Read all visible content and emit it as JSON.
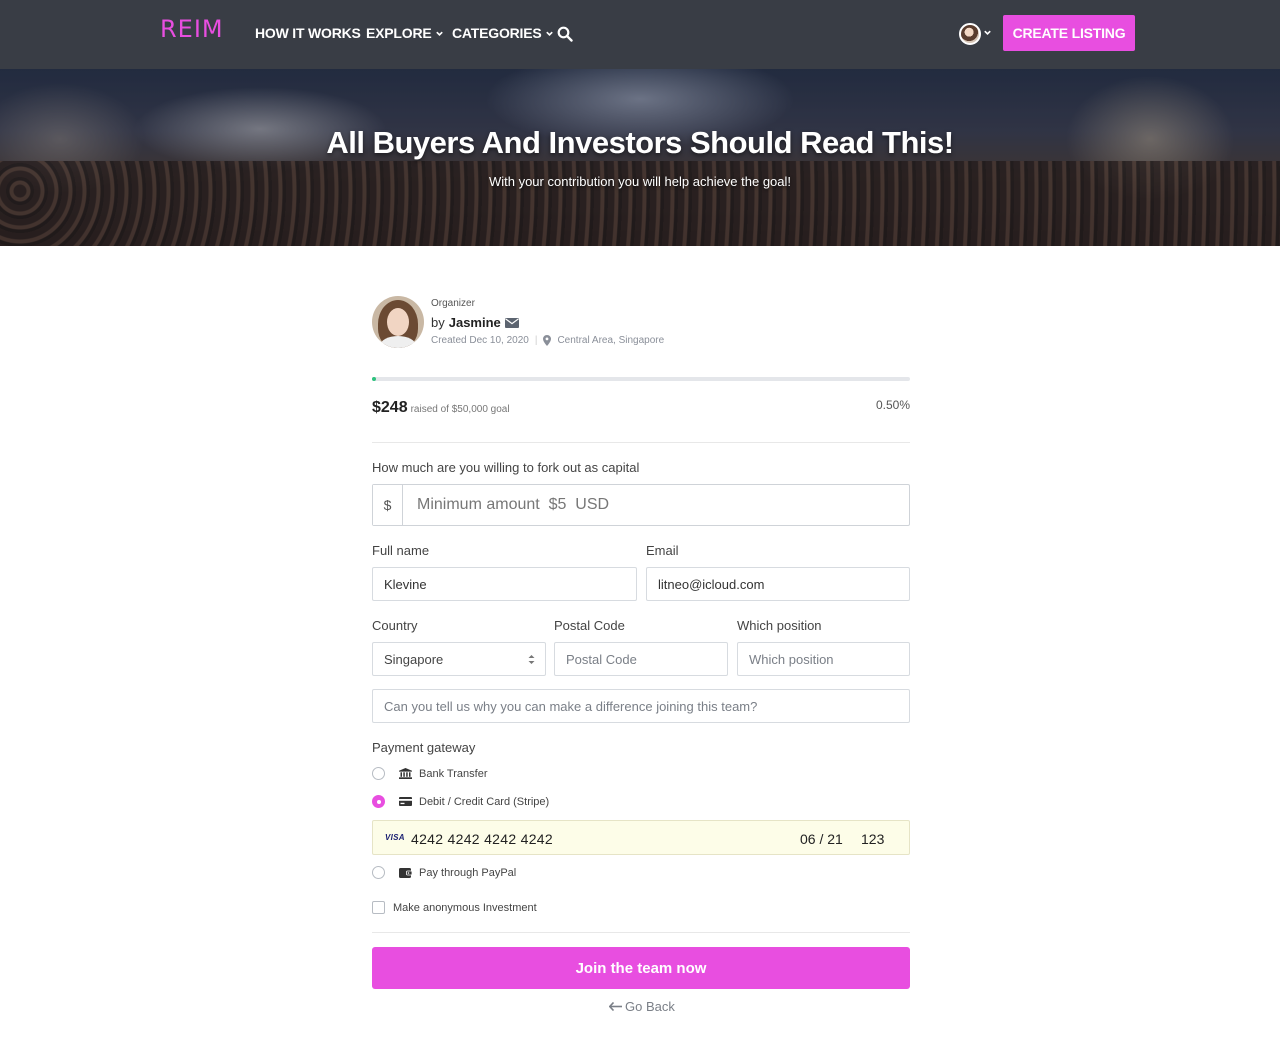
{
  "nav": {
    "logo": "REIM",
    "items": [
      {
        "label": "HOW IT WORKS"
      },
      {
        "label": "EXPLORE"
      },
      {
        "label": "CATEGORIES"
      }
    ],
    "search_icon": "search-icon",
    "create_listing": "CREATE LISTING",
    "brand_color": "#e84ee0"
  },
  "hero": {
    "title": "All Buyers And Investors Should Read This!",
    "subtitle": "With your contribution you will help achieve the goal!"
  },
  "organizer": {
    "label": "Organizer",
    "by": "by",
    "name": "Jasmine",
    "created": "Created Dec 10, 2020",
    "location": "Central Area, Singapore"
  },
  "progress": {
    "raised": "$248",
    "raised_of": "raised of $50,000 goal",
    "percent_text": "0.50%",
    "fraction": 0.005,
    "color": "#2ec27e"
  },
  "form": {
    "capital_label": "How much are you willing to fork out as capital",
    "currency_prefix": "$",
    "amount_placeholder": "Minimum amount  $5  USD",
    "fullname_label": "Full name",
    "fullname_value": "Klevine",
    "email_label": "Email",
    "email_value": "litneo@icloud.com",
    "country_label": "Country",
    "country_value": "Singapore",
    "postal_label": "Postal Code",
    "postal_placeholder": "Postal Code",
    "position_label": "Which position",
    "position_placeholder": "Which position",
    "why_placeholder": "Can you tell us why you can make a difference joining this team?"
  },
  "payment": {
    "label": "Payment gateway",
    "options": [
      {
        "label": "Bank Transfer",
        "icon": "bank-icon",
        "checked": false
      },
      {
        "label": "Debit / Credit Card (Stripe)",
        "icon": "credit-card-icon",
        "checked": true
      },
      {
        "label": "Pay through PayPal",
        "icon": "wallet-icon",
        "checked": false
      }
    ],
    "card": {
      "brand": "VISA",
      "number": "4242 4242 4242 4242",
      "expiry": "06 / 21",
      "cvc": "123"
    },
    "anonymous_label": "Make anonymous Investment"
  },
  "actions": {
    "join": "Join the team now",
    "go_back": "Go Back"
  }
}
